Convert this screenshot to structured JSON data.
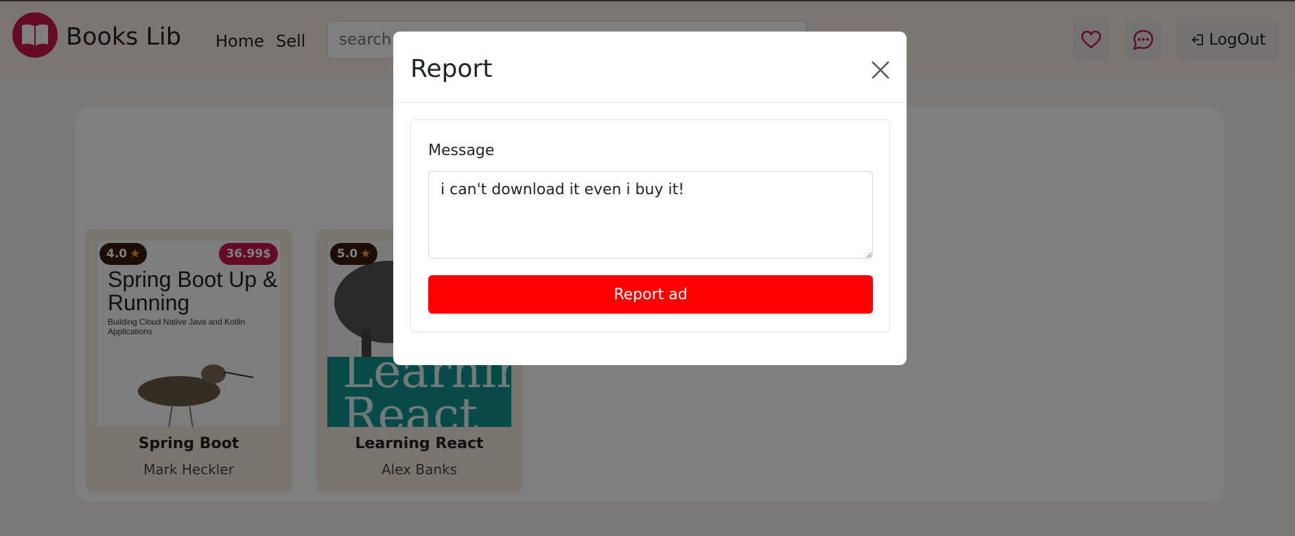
{
  "navbar": {
    "brand": "Books Lib",
    "links": {
      "home": "Home",
      "sell": "Sell"
    },
    "search_placeholder": "search books",
    "logout_label": "LogOut",
    "brand_color": "#c9184a"
  },
  "books": [
    {
      "title": "Spring Boot",
      "author": "Mark Heckler",
      "rating": "4.0",
      "price": "36.99$",
      "cover_title": "Spring Boot Up & Running",
      "cover_subtitle": "Building Cloud Native Java and Kotlin Applications"
    },
    {
      "title": "Learning React",
      "author": "Alex Banks",
      "rating": "5.0",
      "cover_title": "Learning React"
    }
  ],
  "modal": {
    "title": "Report",
    "label": "Message",
    "message_value": "i can't download it even i buy it!",
    "submit_label": "Report ad",
    "submit_color": "#ff0000"
  }
}
